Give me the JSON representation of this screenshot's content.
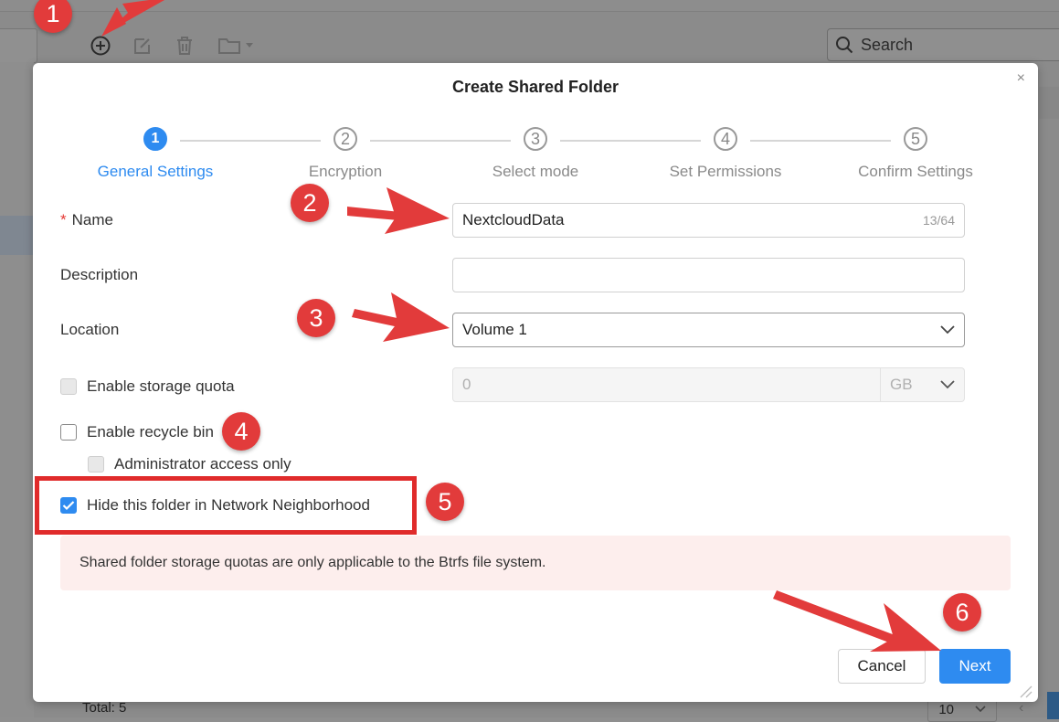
{
  "background": {
    "search_placeholder": "Search",
    "total_label": "Total: 5",
    "page_size": "10",
    "toolbar_icons": [
      "add-icon",
      "edit-icon",
      "trash-icon",
      "folder-icon",
      "chevron-down-icon"
    ]
  },
  "modal": {
    "title": "Create Shared Folder",
    "close": "×",
    "steps": [
      {
        "number": "1",
        "label": "General Settings",
        "active": true
      },
      {
        "number": "2",
        "label": "Encryption",
        "active": false
      },
      {
        "number": "3",
        "label": "Select mode",
        "active": false
      },
      {
        "number": "4",
        "label": "Set Permissions",
        "active": false
      },
      {
        "number": "5",
        "label": "Confirm Settings",
        "active": false
      }
    ],
    "fields": {
      "name": {
        "required_mark": "*",
        "label": "Name",
        "value": "NextcloudData",
        "counter": "13/64"
      },
      "description": {
        "label": "Description",
        "value": ""
      },
      "location": {
        "label": "Location",
        "value": "Volume 1"
      },
      "storage_quota": {
        "label": "Enable storage quota",
        "checked": false,
        "disabled": true,
        "value": "0",
        "unit": "GB"
      },
      "recycle_bin": {
        "label": "Enable recycle bin",
        "checked": false
      },
      "admin_only": {
        "label": "Administrator access only",
        "checked": false,
        "disabled": true
      },
      "hide_folder": {
        "label": "Hide this folder in Network Neighborhood",
        "checked": true
      }
    },
    "notice": "Shared folder storage quotas are only applicable to the Btrfs file system.",
    "buttons": {
      "cancel": "Cancel",
      "next": "Next"
    }
  },
  "annotations": {
    "badges": [
      "1",
      "2",
      "3",
      "4",
      "5",
      "6"
    ],
    "color": "#e23b3b"
  },
  "colors": {
    "accent": "#2e8bf0",
    "notice_bg": "#fdeeed",
    "annotation": "#e23b3b"
  }
}
